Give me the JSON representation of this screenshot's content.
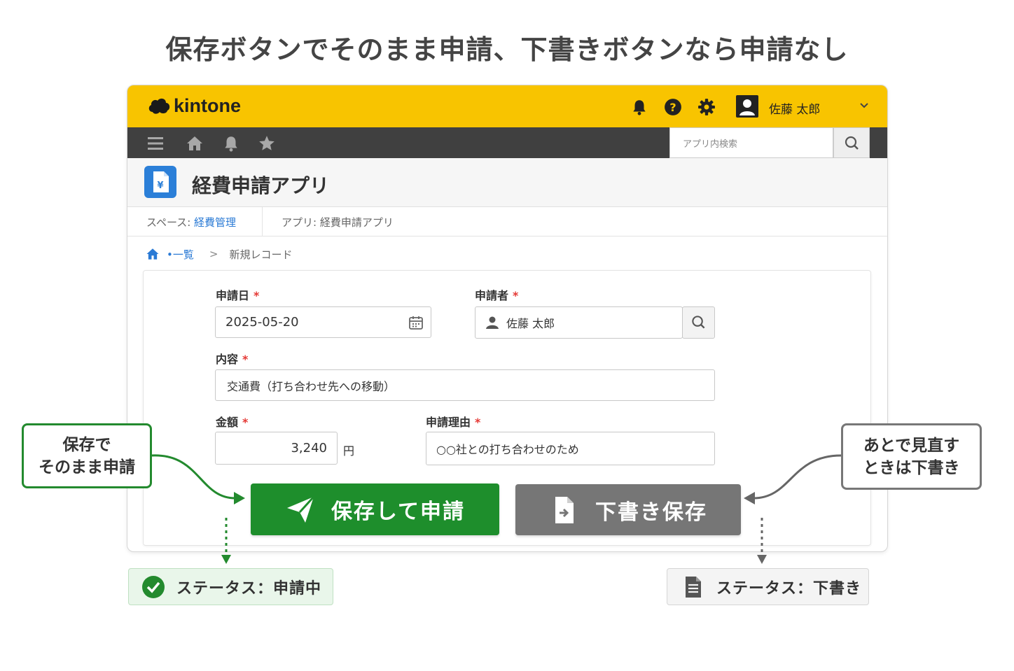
{
  "headline": "保存ボタンでそのまま申請、下書きボタンなら申請なし",
  "topbar": {
    "brand": "kintone",
    "user_name": "佐藤 太郎",
    "icons": [
      "bell-icon",
      "help-icon",
      "gear-icon",
      "user-avatar-icon",
      "chevron-down-icon"
    ],
    "color": "#f8c400"
  },
  "navbar": {
    "icons": [
      "menu-icon",
      "home-icon",
      "bell-icon",
      "star-icon"
    ],
    "search_placeholder": "アプリ内検索"
  },
  "app": {
    "title": "経費申請アプリ",
    "icon": "document-yen-icon"
  },
  "breadcrumb": {
    "space_prefix": "スペース: ",
    "space_name": "経費管理",
    "app_label": "アプリ: 経費申請アプリ"
  },
  "path": {
    "list_label": "•一覧",
    "separator": ">",
    "current": "新規レコード"
  },
  "form": {
    "required_mark": "*",
    "fields": {
      "date": {
        "label": "申請日",
        "value": "2025-05-20"
      },
      "applicant": {
        "label": "申請者",
        "value": "佐藤 太郎"
      },
      "content": {
        "label": "内容",
        "value": "交通費（打ち合わせ先への移動）"
      },
      "amount": {
        "label": "金額",
        "value": "3,240",
        "unit": "円"
      },
      "reason": {
        "label": "申請理由",
        "value": "○○社との打ち合わせのため"
      }
    },
    "submit_label": "保存して申請",
    "draft_label": "下書き保存"
  },
  "callouts": {
    "left": [
      "保存で",
      "そのまま申請"
    ],
    "right": [
      "あとで見直す",
      "ときは下書き"
    ]
  },
  "status": {
    "submitted": "ステータス：申請中",
    "draft": "ステータス：下書き"
  },
  "colors": {
    "submit": "#1e8e2c",
    "draft": "#767676",
    "link": "#2a7ad5",
    "required": "#e53935"
  }
}
